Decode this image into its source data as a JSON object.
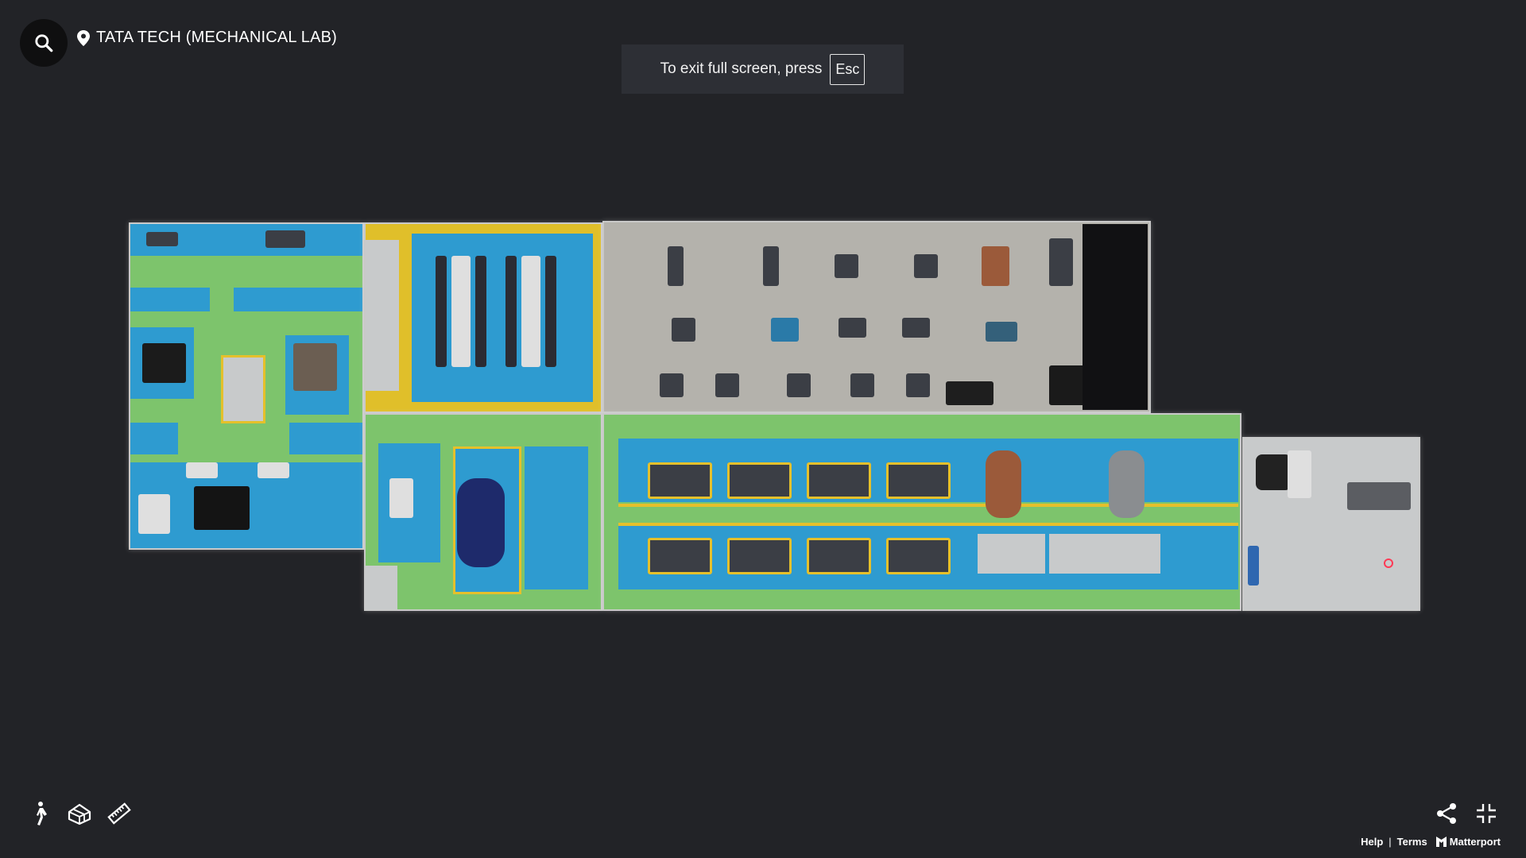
{
  "header": {
    "title": "TATA TECH (MECHANICAL LAB)",
    "search_icon": "search-icon",
    "location_icon": "location-pin-icon"
  },
  "banner": {
    "text": "To exit full screen, press",
    "key": "Esc"
  },
  "toolbar": {
    "left_icons": [
      "walk-mode-icon",
      "dollhouse-icon",
      "measure-icon"
    ],
    "right_icons": [
      "share-icon",
      "exit-fullscreen-icon"
    ]
  },
  "footer": {
    "help": "Help",
    "separator": "|",
    "terms": "Terms",
    "brand": "Matterport",
    "brand_icon": "matterport-logo-icon"
  },
  "colors": {
    "background": "#222327",
    "search_button_bg": "#0f0f10",
    "banner_bg": "#2d2f35"
  }
}
